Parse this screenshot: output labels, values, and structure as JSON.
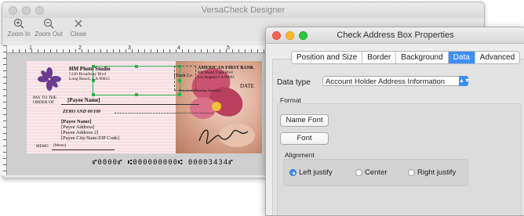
{
  "designer": {
    "title": "VersaCheck Designer",
    "toolbar": [
      {
        "label": "Zoom In",
        "icon": "zoom-in-icon"
      },
      {
        "label": "Zoom Out",
        "icon": "zoom-out-icon"
      },
      {
        "label": "Close",
        "icon": "close-icon"
      }
    ],
    "ruler_numbers": [
      "0",
      "1",
      "2",
      "3",
      "4",
      "5",
      "6",
      "7",
      "8"
    ]
  },
  "check": {
    "payer_name": "HM Photo Studio",
    "payer_address1": "5120 Broadway Blvd",
    "payer_address2": "Long Beach, CA 90815",
    "bank_box": "[Bank Lo",
    "bank_name": "AMERICAN FIRST BANK",
    "bank_address1": "800 World Trade Blvd",
    "bank_address2": "Los Angeles CA 90001",
    "fractional": "[Fractional Routing Number]",
    "date_label": "DATE",
    "pay_to_line1": "PAY TO THE",
    "pay_to_line2": "ORDER OF",
    "payee_name_field": "[Payee Name]",
    "amount_words": "ZERO AND 00/100",
    "payee_block": [
      "[Payee Name]",
      "[Payee Address]",
      "[Payee Address 2]",
      "[Payee City/State/ZIP Code]"
    ],
    "memo_label": "MEMO",
    "memo_field": "[Memo]",
    "micr": "⑈0000⑈ ⑆000000000⑆ 00003434⑈"
  },
  "props": {
    "title": "Check Address Box Properties",
    "tabs": [
      "Position and Size",
      "Border",
      "Background",
      "Data",
      "Advanced"
    ],
    "active_tab": "Data",
    "data_type_label": "Data type",
    "data_type_value": "Account Holder Address Information",
    "format_label": "Format",
    "name_font_button": "Name Font",
    "font_button": "Font",
    "alignment_label": "Alignment",
    "alignment_options": [
      "Left justify",
      "Center",
      "Right justify"
    ],
    "alignment_selected": "Left justify"
  },
  "colors": {
    "accent": "#3d8ef6",
    "selection": "#2db34a",
    "check_bg": "#f7dfe4",
    "logo": "#6b3c8e"
  }
}
